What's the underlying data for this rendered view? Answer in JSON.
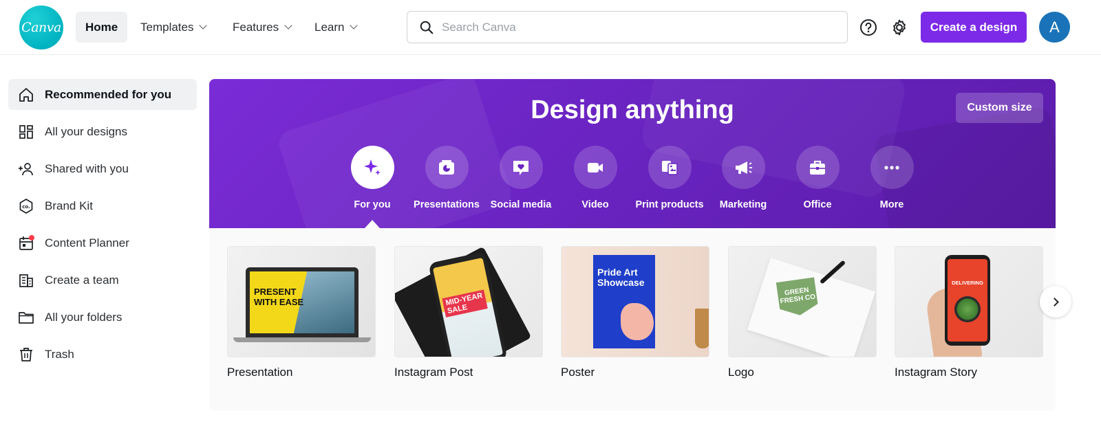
{
  "app": {
    "logo_text": "Canva"
  },
  "nav": {
    "home": "Home",
    "templates": "Templates",
    "features": "Features",
    "learn": "Learn"
  },
  "search": {
    "placeholder": "Search Canva"
  },
  "header": {
    "create_label": "Create a design",
    "avatar_initial": "A"
  },
  "sidebar": {
    "items": [
      {
        "label": "Recommended for you",
        "icon": "home-icon"
      },
      {
        "label": "All your designs",
        "icon": "grid-icon"
      },
      {
        "label": "Shared with you",
        "icon": "users-icon"
      },
      {
        "label": "Brand Kit",
        "icon": "brand-kit-icon"
      },
      {
        "label": "Content Planner",
        "icon": "calendar-icon"
      },
      {
        "label": "Create a team",
        "icon": "building-icon"
      },
      {
        "label": "All your folders",
        "icon": "folder-icon"
      },
      {
        "label": "Trash",
        "icon": "trash-icon"
      }
    ]
  },
  "hero": {
    "title": "Design anything",
    "custom_size_label": "Custom size",
    "categories": [
      {
        "label": "For you",
        "icon": "sparkle-icon"
      },
      {
        "label": "Presentations",
        "icon": "presentation-icon"
      },
      {
        "label": "Social media",
        "icon": "heart-chat-icon"
      },
      {
        "label": "Video",
        "icon": "video-camera-icon"
      },
      {
        "label": "Print products",
        "icon": "print-products-icon"
      },
      {
        "label": "Marketing",
        "icon": "megaphone-icon"
      },
      {
        "label": "Office",
        "icon": "briefcase-icon"
      },
      {
        "label": "More",
        "icon": "more-dots-icon"
      }
    ]
  },
  "templates": [
    {
      "title": "Presentation",
      "art_text": "PRESENT\nWITH EASE"
    },
    {
      "title": "Instagram Post",
      "art_text": "MID-YEAR\nSALE"
    },
    {
      "title": "Poster",
      "art_text": "Pride Art\nShowcase"
    },
    {
      "title": "Logo",
      "art_text": "GREEN\nFRESH CO"
    },
    {
      "title": "Instagram Story",
      "art_text": "DELIVERING"
    }
  ],
  "colors": {
    "brand_purple": "#7d2ae8",
    "logo_teal": "#00c4cc",
    "avatar_blue": "#1a73b8"
  }
}
